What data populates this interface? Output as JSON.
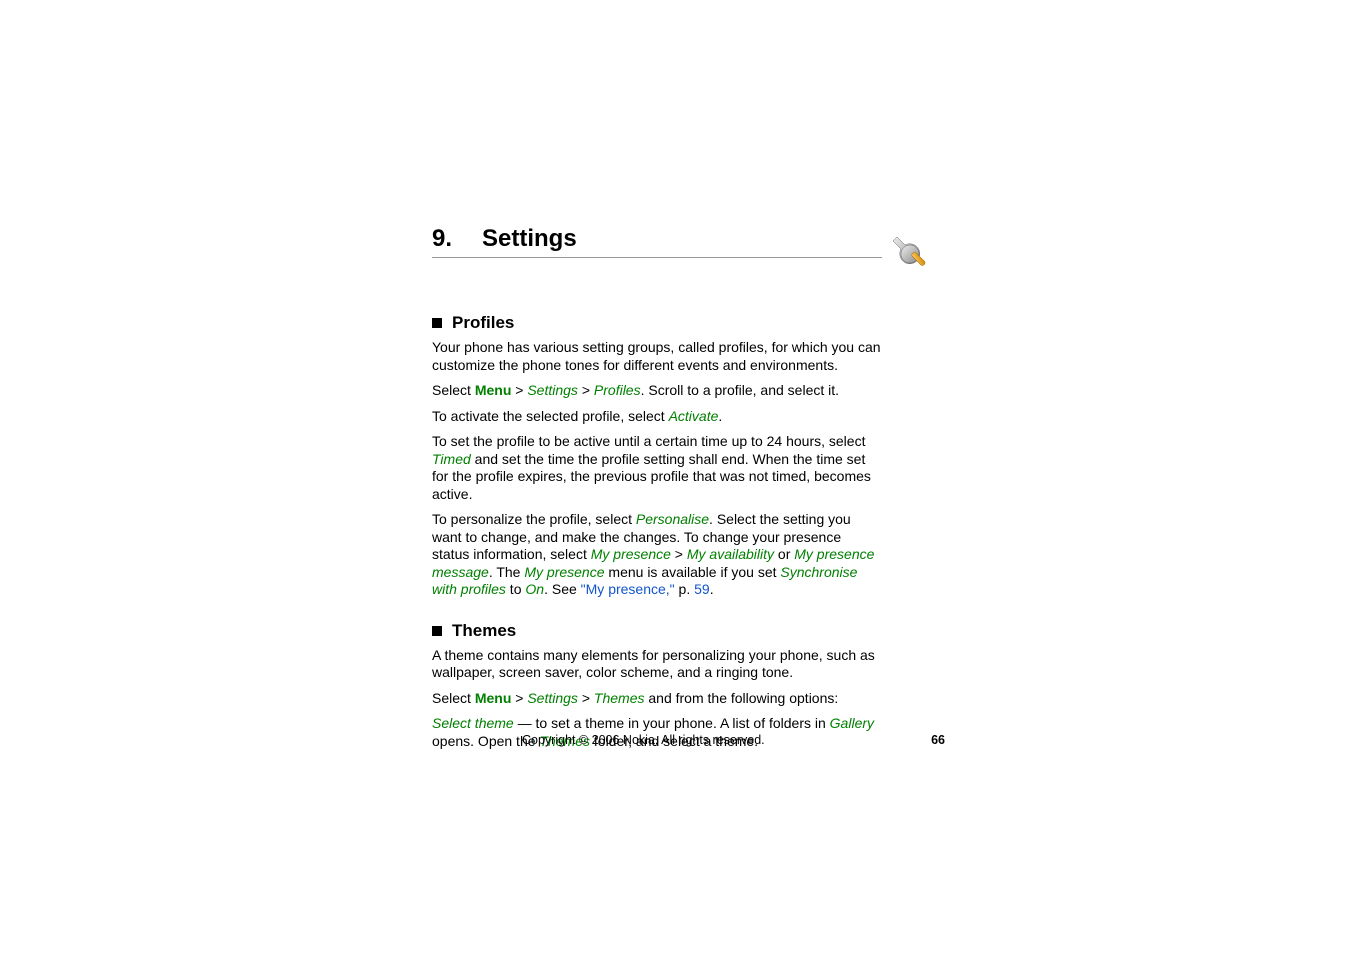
{
  "chapter": {
    "number": "9.",
    "title": "Settings"
  },
  "sections": {
    "profiles": {
      "heading": "Profiles",
      "para1": "Your phone has various setting groups, called profiles, for which you can customize the phone tones for different events and environments.",
      "para2_prefix": "Select ",
      "para2_menu": "Menu",
      "para2_gt1": " > ",
      "para2_settings": "Settings",
      "para2_gt2": " > ",
      "para2_profiles": "Profiles",
      "para2_suffix": ". Scroll to a profile, and select it.",
      "para3_prefix": "To activate the selected profile, select ",
      "para3_activate": "Activate",
      "para3_suffix": ".",
      "para4_prefix": "To set the profile to be active until a certain time up to 24 hours, select ",
      "para4_timed": "Timed",
      "para4_suffix": " and set the time the profile setting shall end. When the time set for the profile expires, the previous profile that was not timed, becomes active.",
      "para5_prefix": "To personalize the profile, select ",
      "para5_personalise": "Personalise",
      "para5_mid1": ". Select the setting you want to change, and make the changes. To change your presence status information, select ",
      "para5_mypresence1": "My presence",
      "para5_gt3": " > ",
      "para5_myavail": "My availability",
      "para5_or": " or ",
      "para5_mypresmsg": "My presence message",
      "para5_mid2": ". The ",
      "para5_mypresence2": "My presence",
      "para5_mid3": " menu is available if you set ",
      "para5_sync": "Synchronise with profiles",
      "para5_to": " to ",
      "para5_on": "On",
      "para5_mid4": ". See ",
      "para5_ref": "\"My presence,\"",
      "para5_p": " p. ",
      "para5_pagenum": "59",
      "para5_end": "."
    },
    "themes": {
      "heading": "Themes",
      "para1": "A theme contains many elements for personalizing your phone, such as wallpaper, screen saver, color scheme, and a ringing tone.",
      "para2_prefix": "Select ",
      "para2_menu": "Menu",
      "para2_gt1": " > ",
      "para2_settings": "Settings",
      "para2_gt2": " > ",
      "para2_themes": "Themes",
      "para2_suffix": " and from the following options:",
      "para3_select": "Select theme",
      "para3_mid1": " — to set a theme in your phone. A list of folders in ",
      "para3_gallery": "Gallery",
      "para3_mid2": " opens. Open the ",
      "para3_themes2": "Themes",
      "para3_suffix": " folder, and select a theme."
    }
  },
  "footer": {
    "copyright": "Copyright © 2006 Nokia. All rights reserved.",
    "page": "66"
  }
}
